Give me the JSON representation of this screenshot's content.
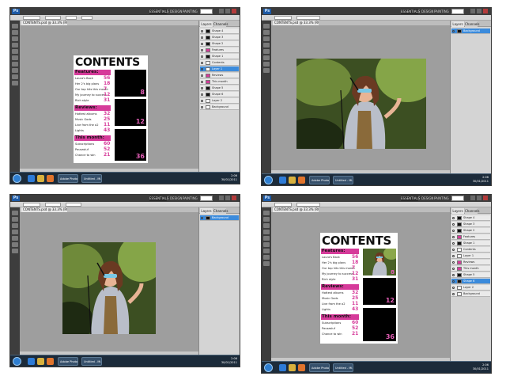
{
  "app": {
    "logo_text": "Ps",
    "workspace_label": "ESSENTIALS",
    "workspace_items": [
      "DESIGN",
      "PAINTING"
    ],
    "doc_tab_title": "CONTENTS.psd @ 33.3% (RGB/8)"
  },
  "layers_panel": {
    "tabs": [
      "Layers",
      "Channels"
    ],
    "contents_layers": [
      "Shape 4",
      "Shape 3",
      "Shape 2",
      "Features",
      "Shape 1",
      "Contents",
      "Layer 1",
      "Reviews",
      "This month",
      "Shape 5",
      "Shape 6",
      "Layer 2",
      "Background"
    ],
    "photo_layers": [
      "Background"
    ],
    "selected_contents_index": 6,
    "selected_photo_index": 0
  },
  "contents_page": {
    "title": "CONTENTS",
    "sections": {
      "features": "Features:",
      "reviews": "Reviews:",
      "this_month": "This month:"
    },
    "features_items": [
      {
        "label": "Laura's Back",
        "page": "56"
      },
      {
        "label": "Her 2's big plans",
        "page": "18"
      },
      {
        "label": "Our top hits this month",
        "page": "7"
      },
      {
        "label": "My journey to success",
        "page": "12"
      },
      {
        "label": "Rich style",
        "page": "31"
      }
    ],
    "reviews_items": [
      {
        "label": "Hottest albums",
        "page": "32"
      },
      {
        "label": "Music Gods",
        "page": "25"
      },
      {
        "label": "Live from the o2",
        "page": "11"
      },
      {
        "label": "Lights",
        "page": "43"
      }
    ],
    "this_month_items": [
      {
        "label": "Subscriptions",
        "page": "60"
      },
      {
        "label": "Pausasluf",
        "page": "52"
      },
      {
        "label": "Chance to win",
        "page": "21"
      }
    ],
    "box_numbers": [
      "8",
      "12",
      "36"
    ]
  },
  "taskbar": {
    "buttons": [
      "Adobe Photoshop",
      "Untitled - Mi..."
    ],
    "time": "2:06",
    "date": "30/01/2011"
  },
  "colors": {
    "accent_pink": "#d63a9a",
    "selection_blue": "#3b8bdc",
    "photoshop_dark": "#3c3c3c",
    "canvas_gray": "#9e9e9e"
  }
}
